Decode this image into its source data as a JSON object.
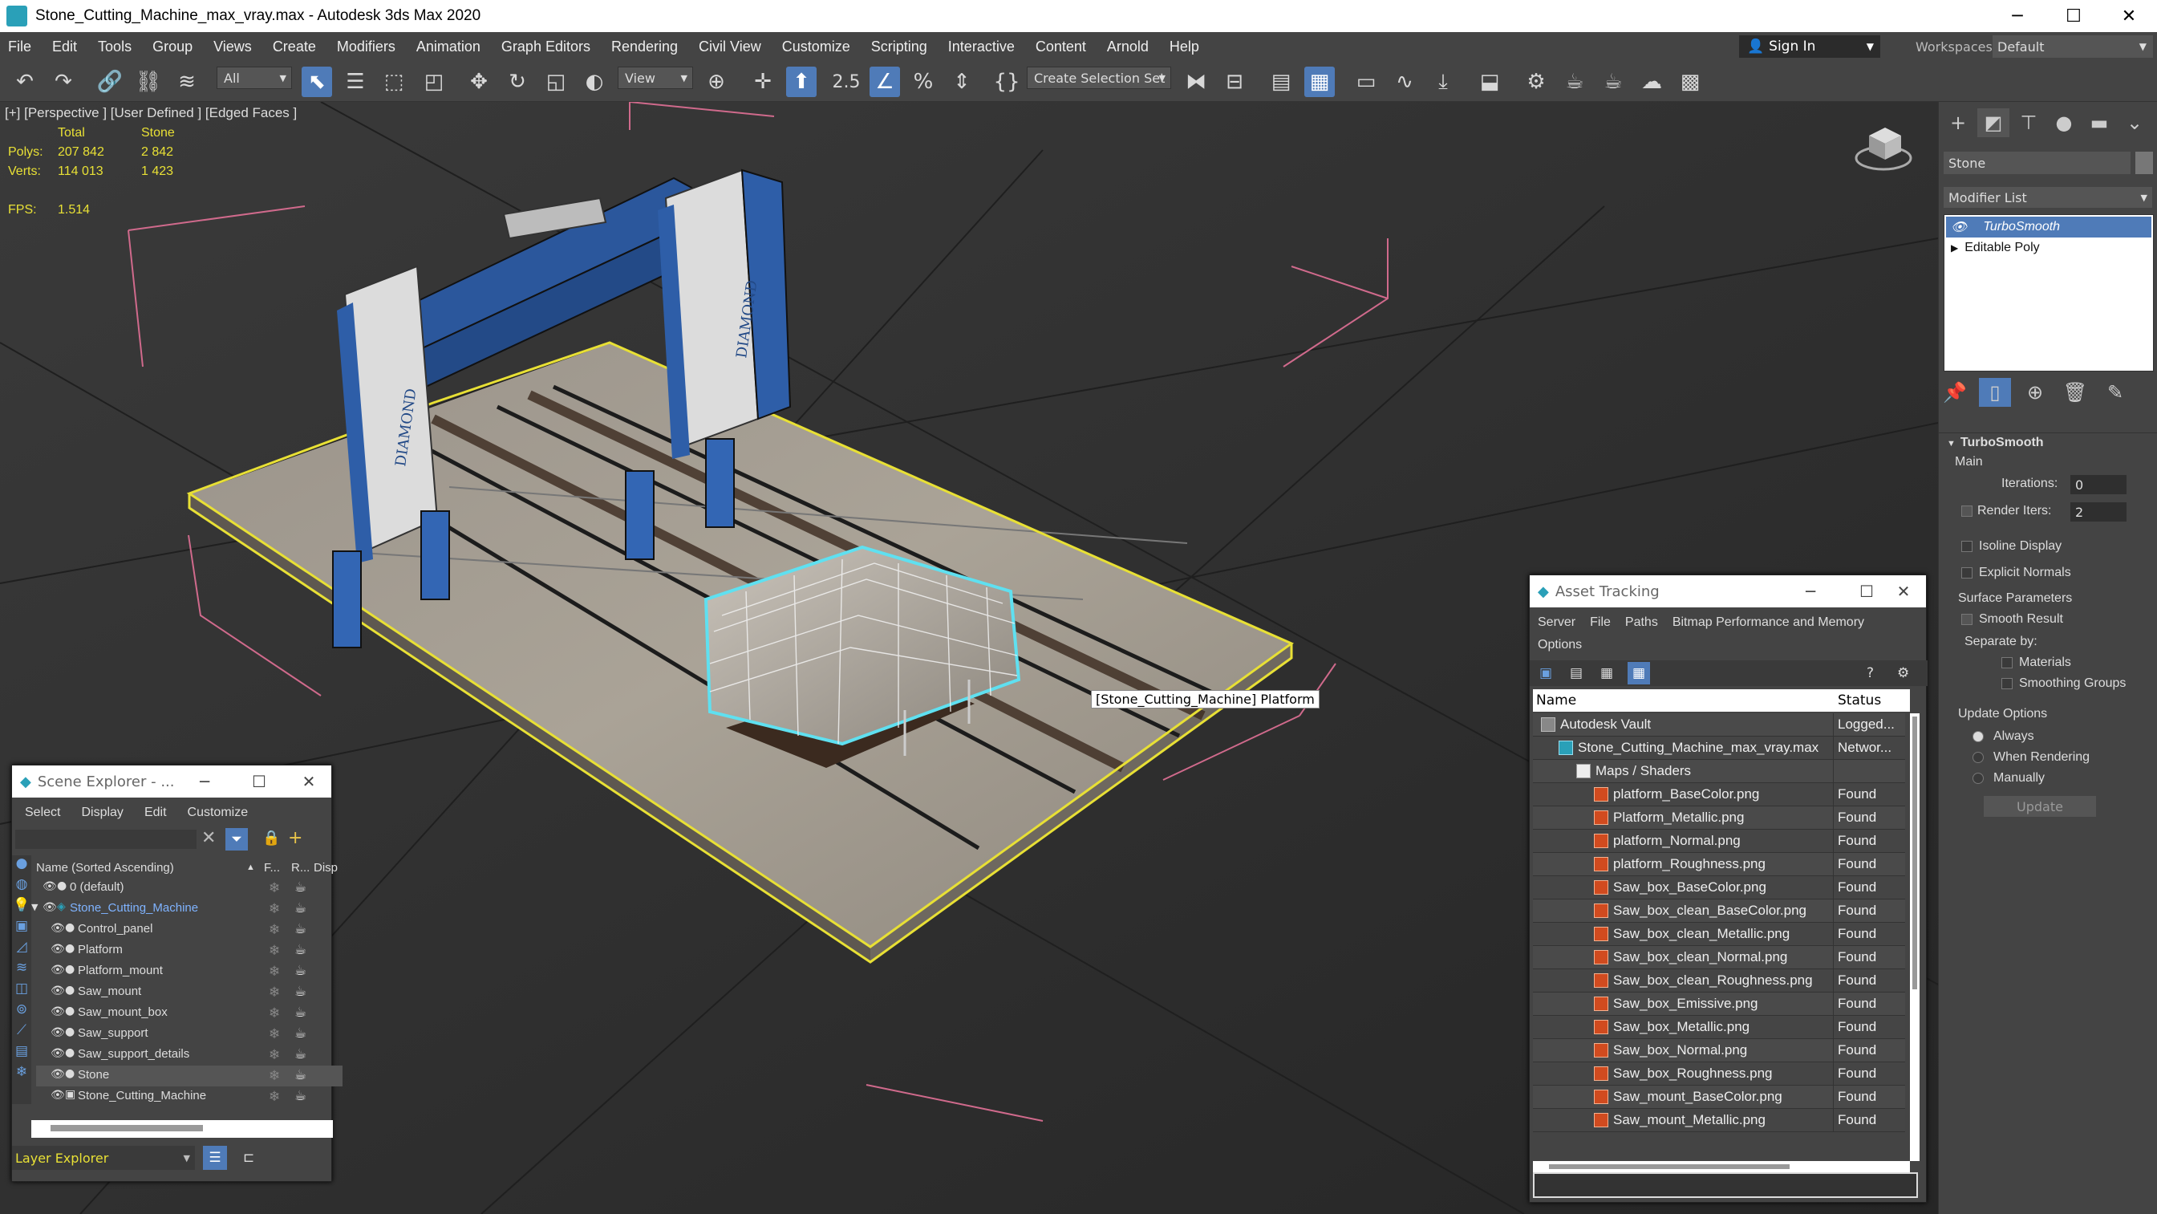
{
  "window": {
    "title": "Stone_Cutting_Machine_max_vray.max - Autodesk 3ds Max 2020",
    "minimize": "─",
    "maximize": "☐",
    "close": "✕"
  },
  "menu": [
    "File",
    "Edit",
    "Tools",
    "Group",
    "Views",
    "Create",
    "Modifiers",
    "Animation",
    "Graph Editors",
    "Rendering",
    "Civil View",
    "Customize",
    "Scripting",
    "Interactive",
    "Content",
    "Arnold",
    "Help"
  ],
  "account": {
    "signin": "Sign In",
    "workspaces_label": "Workspaces:",
    "workspace": "Default"
  },
  "toolbar": {
    "filter": "All",
    "view": "View",
    "selection_set": "Create Selection Set",
    "snap_25": "2.5"
  },
  "viewport": {
    "label": "[+] [Perspective ] [User Defined ] [Edged Faces ]",
    "stats_head_total": "Total",
    "stats_head_obj": "Stone",
    "polys_label": "Polys:",
    "polys_total": "207 842",
    "polys_obj": "2 842",
    "verts_label": "Verts:",
    "verts_total": "114 013",
    "verts_obj": "1 423",
    "fps_label": "FPS:",
    "fps": "1.514",
    "tooltip": "[Stone_Cutting_Machine] Platform",
    "brand_diamond": "DIAMOND"
  },
  "command_panel": {
    "object_name": "Stone",
    "modifier_list": "Modifier List",
    "stack": [
      "TurboSmooth",
      "Editable Poly"
    ],
    "rollout": "TurboSmooth",
    "main": "Main",
    "iterations_label": "Iterations:",
    "iterations": "0",
    "render_iters_label": "Render Iters:",
    "render_iters": "2",
    "isoline": "Isoline Display",
    "explicit_normals": "Explicit Normals",
    "surface_params": "Surface Parameters",
    "smooth_result": "Smooth Result",
    "separate_by": "Separate by:",
    "materials": "Materials",
    "smoothing_groups": "Smoothing Groups",
    "update_options": "Update Options",
    "always": "Always",
    "when_rendering": "When Rendering",
    "manually": "Manually",
    "update_btn": "Update"
  },
  "scene_explorer": {
    "title": "Scene Explorer - ...",
    "menus": [
      "Select",
      "Display",
      "Edit",
      "Customize"
    ],
    "col_name": "Name (Sorted Ascending)",
    "col_f": "F...",
    "col_r": "R...",
    "col_disp": "Disp",
    "items": [
      {
        "name": "0 (default)",
        "level": 0
      },
      {
        "name": "Stone_Cutting_Machine",
        "level": 0
      },
      {
        "name": "Control_panel",
        "level": 1
      },
      {
        "name": "Platform",
        "level": 1
      },
      {
        "name": "Platform_mount",
        "level": 1
      },
      {
        "name": "Saw_mount",
        "level": 1
      },
      {
        "name": "Saw_mount_box",
        "level": 1
      },
      {
        "name": "Saw_support",
        "level": 1
      },
      {
        "name": "Saw_support_details",
        "level": 1
      },
      {
        "name": "Stone",
        "level": 1
      },
      {
        "name": "Stone_Cutting_Machine",
        "level": 1
      }
    ],
    "footer": "Layer Explorer"
  },
  "asset_tracking": {
    "title": "Asset Tracking",
    "menus": [
      "Server",
      "File",
      "Paths",
      "Bitmap Performance and Memory",
      "Options"
    ],
    "col_name": "Name",
    "col_status": "Status",
    "rows": [
      {
        "name": "Autodesk Vault",
        "status": "Logged...",
        "indent": 0,
        "kind": "vault"
      },
      {
        "name": "Stone_Cutting_Machine_max_vray.max",
        "status": "Networ...",
        "indent": 1,
        "kind": "max"
      },
      {
        "name": "Maps / Shaders",
        "status": "",
        "indent": 2,
        "kind": "folder"
      },
      {
        "name": "platform_BaseColor.png",
        "status": "Found",
        "indent": 3,
        "kind": "png"
      },
      {
        "name": "Platform_Metallic.png",
        "status": "Found",
        "indent": 3,
        "kind": "png"
      },
      {
        "name": "platform_Normal.png",
        "status": "Found",
        "indent": 3,
        "kind": "png"
      },
      {
        "name": "platform_Roughness.png",
        "status": "Found",
        "indent": 3,
        "kind": "png"
      },
      {
        "name": "Saw_box_BaseColor.png",
        "status": "Found",
        "indent": 3,
        "kind": "png"
      },
      {
        "name": "Saw_box_clean_BaseColor.png",
        "status": "Found",
        "indent": 3,
        "kind": "png"
      },
      {
        "name": "Saw_box_clean_Metallic.png",
        "status": "Found",
        "indent": 3,
        "kind": "png"
      },
      {
        "name": "Saw_box_clean_Normal.png",
        "status": "Found",
        "indent": 3,
        "kind": "png"
      },
      {
        "name": "Saw_box_clean_Roughness.png",
        "status": "Found",
        "indent": 3,
        "kind": "png"
      },
      {
        "name": "Saw_box_Emissive.png",
        "status": "Found",
        "indent": 3,
        "kind": "png"
      },
      {
        "name": "Saw_box_Metallic.png",
        "status": "Found",
        "indent": 3,
        "kind": "png"
      },
      {
        "name": "Saw_box_Normal.png",
        "status": "Found",
        "indent": 3,
        "kind": "png"
      },
      {
        "name": "Saw_box_Roughness.png",
        "status": "Found",
        "indent": 3,
        "kind": "png"
      },
      {
        "name": "Saw_mount_BaseColor.png",
        "status": "Found",
        "indent": 3,
        "kind": "png"
      },
      {
        "name": "Saw_mount_Metallic.png",
        "status": "Found",
        "indent": 3,
        "kind": "png"
      }
    ]
  },
  "colors": {
    "selection_yellow": "#e8e035",
    "stone_cyan": "#5fe0f0",
    "machine_blue": "#2e5ea8",
    "accent": "#4f7bb8"
  }
}
